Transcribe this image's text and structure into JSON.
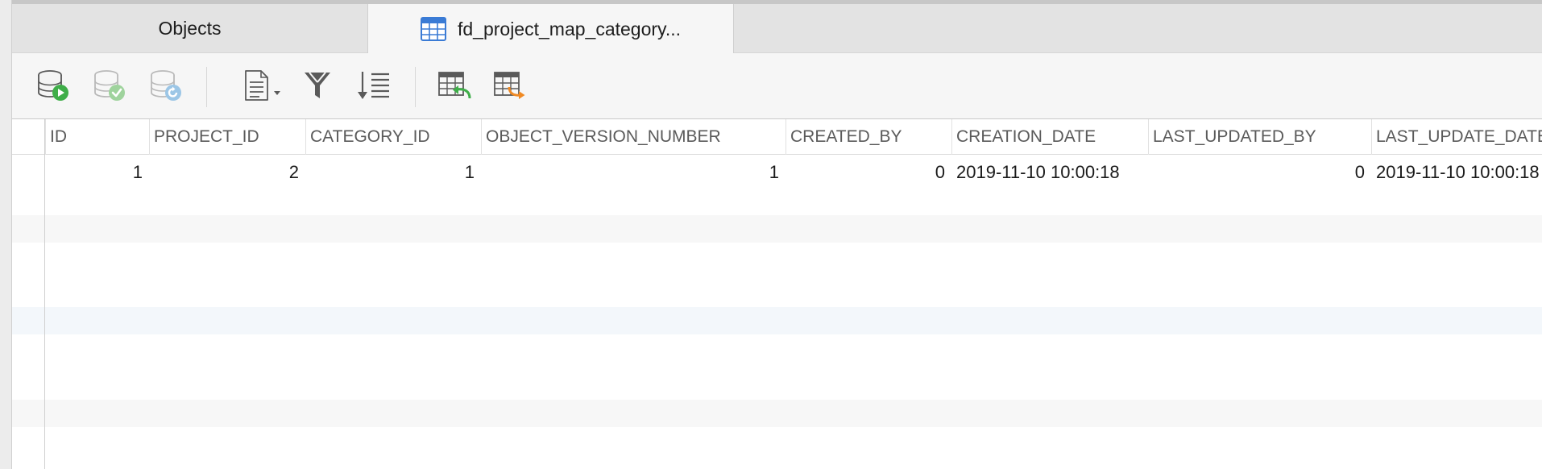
{
  "tabs": [
    {
      "label": "Objects",
      "active": false,
      "icon": "none"
    },
    {
      "label": "fd_project_map_category...",
      "active": true,
      "icon": "table-icon"
    }
  ],
  "toolbar": {
    "buttons": [
      {
        "name": "begin-transaction-button",
        "icon": "database-play-icon"
      },
      {
        "name": "commit-button",
        "icon": "database-check-icon"
      },
      {
        "name": "rollback-button",
        "icon": "database-revert-icon"
      },
      {
        "name": "text-view-button",
        "icon": "document-dropdown-icon"
      },
      {
        "name": "filter-button",
        "icon": "funnel-icon"
      },
      {
        "name": "sort-button",
        "icon": "sort-icon"
      },
      {
        "name": "import-button",
        "icon": "table-import-icon"
      },
      {
        "name": "export-button",
        "icon": "table-export-icon"
      }
    ]
  },
  "grid": {
    "columns": [
      "ID",
      "PROJECT_ID",
      "CATEGORY_ID",
      "OBJECT_VERSION_NUMBER",
      "CREATED_BY",
      "CREATION_DATE",
      "LAST_UPDATED_BY",
      "LAST_UPDATE_DATE"
    ],
    "rows": [
      [
        "1",
        "2",
        "1",
        "1",
        "0",
        "2019-11-10 10:00:18",
        "0",
        "2019-11-10 10:00:18"
      ]
    ]
  },
  "colors": {
    "tab_bar": "#e3e3e3",
    "active_tab": "#f6f6f6",
    "header_text": "#5a5a5a",
    "stripe": "#f7f7f7",
    "stripe_selected": "#f3f7fb",
    "accent_blue": "#3a7bd5",
    "accent_green": "#3fae49",
    "accent_orange": "#f08a24"
  }
}
